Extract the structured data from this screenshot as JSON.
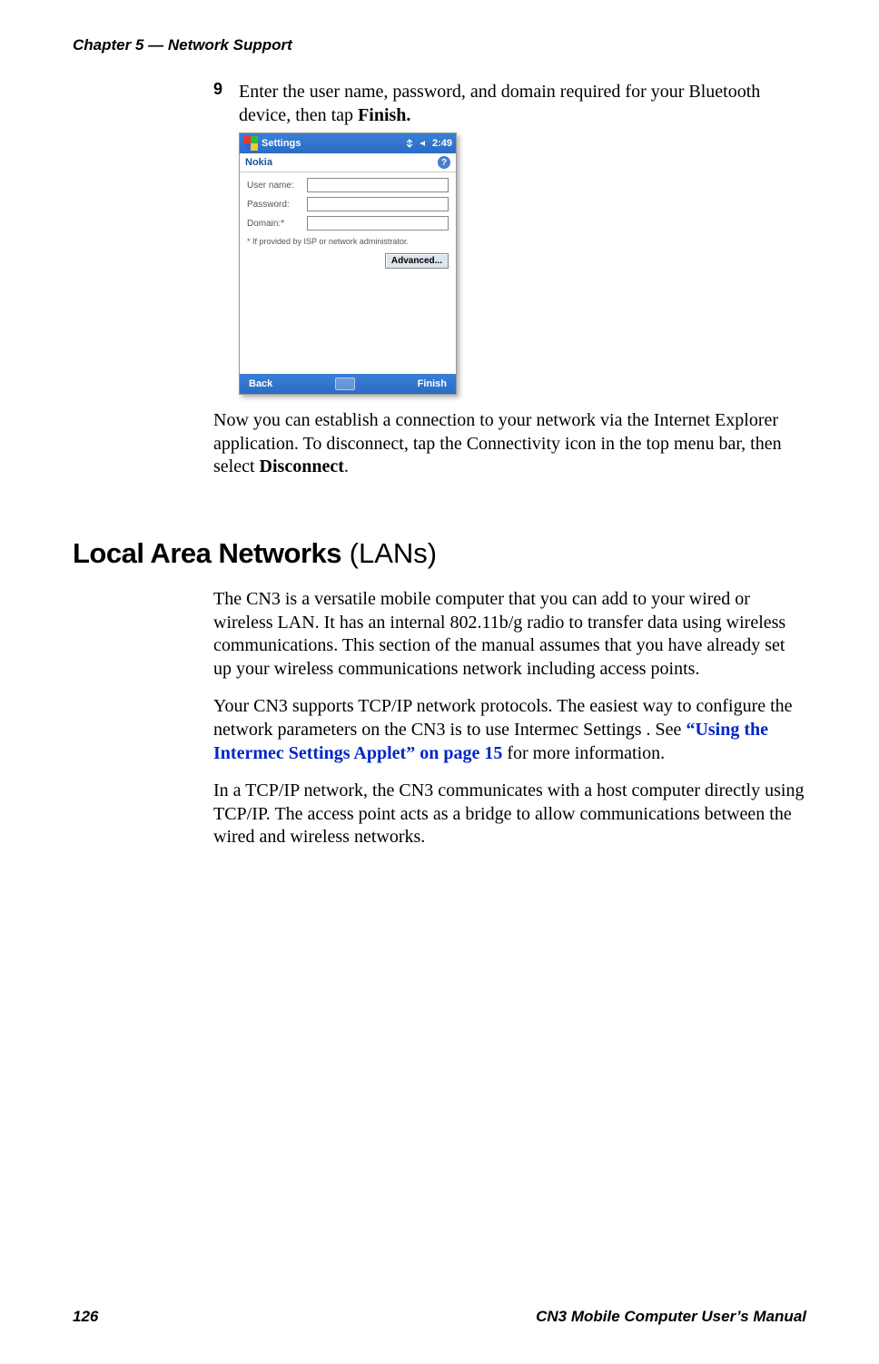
{
  "header": {
    "chapter": "Chapter 5 — Network Support"
  },
  "step": {
    "number": "9",
    "prefix": "Enter the user name, password, and domain required for your Bluetooth device, then tap ",
    "bold": "Finish."
  },
  "screenshot": {
    "titlebar": {
      "title": "Settings",
      "time": "2:49"
    },
    "subhead": {
      "label": "Nokia"
    },
    "fields": {
      "user": "User name:",
      "pass": "Password:",
      "domain": "Domain:*"
    },
    "footnote": "* If provided by ISP or network administrator.",
    "advanced": "Advanced...",
    "bottombar": {
      "back": "Back",
      "finish": "Finish"
    }
  },
  "after_screenshot": {
    "part1": "Now you can establish a connection to your network via the Internet Explorer application. To disconnect, tap the Connectivity icon in the top menu bar, then select ",
    "bold": "Disconnect",
    "part2": "."
  },
  "heading": {
    "bold": "Local Area Networks",
    "thin": " (LANs)"
  },
  "body": {
    "p1": "The CN3 is a versatile mobile computer that you can add to your wired or wireless LAN. It has an internal 802.11b/g radio to transfer data using wireless communications. This section of the manual assumes that you have already set up your wireless communications network including access points.",
    "p2_pre": "Your CN3 supports TCP/IP network protocols. The easiest way to configure the network parameters on the CN3 is to use Intermec Settings . See ",
    "p2_link": "“Using the Intermec Settings Applet” on page 15",
    "p2_post": " for more information.",
    "p3": "In a TCP/IP network, the CN3 communicates with a host computer directly using TCP/IP. The access point acts as a bridge to allow communications between the wired and wireless networks."
  },
  "footer": {
    "page": "126",
    "manual": "CN3 Mobile Computer User’s Manual"
  }
}
